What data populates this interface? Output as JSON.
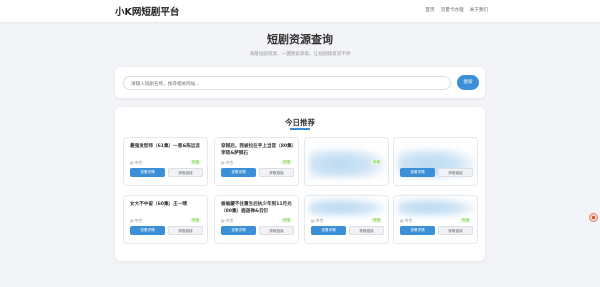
{
  "navbar": {
    "brand": "小K网短剧平台",
    "links": [
      "首页",
      "流量卡办理",
      "关于我们"
    ]
  },
  "hero": {
    "title": "短剧资源查询",
    "subtitle": "海量短剧资源，一键搜索获取，让短剧随意赏不停"
  },
  "search": {
    "placeholder": "请输入短剧名称，搜尋相关网站...",
    "button_label": "搜索"
  },
  "recommend": {
    "title": "今日推荐",
    "items": [
      {
        "title": "最强发型师（61集）一恩&陈远言",
        "meta": "夸克",
        "status": "可用",
        "primary": "查看详情",
        "secondary": "获取链接"
      },
      {
        "title": "穿越后，我被拉在手上当宫（80集）李晓&萨钢石",
        "meta": "夸克",
        "status": "可用",
        "primary": "查看详情",
        "secondary": "获取链接"
      },
      {
        "title": "",
        "meta": "",
        "status": "可用",
        "primary": "",
        "secondary": ""
      },
      {
        "title": "",
        "meta": "",
        "status": "",
        "primary": "查看详情",
        "secondary": "获取链接"
      },
      {
        "title": "女大不中留（60集）王一晴",
        "meta": "夸克",
        "status": "可用",
        "primary": "查看详情",
        "secondary": "获取链接"
      },
      {
        "title": "偷偷藏不住重生后执少年到11月光（80集）鹿迦禅&云衍",
        "meta": "夸克",
        "status": "可用",
        "primary": "查看详情",
        "secondary": "获取链接"
      },
      {
        "title": "",
        "meta": "夸克",
        "status": "可用",
        "primary": "查看详情",
        "secondary": "获取链接"
      },
      {
        "title": "",
        "meta": "夸克",
        "status": "可用",
        "primary": "查看详情",
        "secondary": "获取链接"
      }
    ]
  }
}
